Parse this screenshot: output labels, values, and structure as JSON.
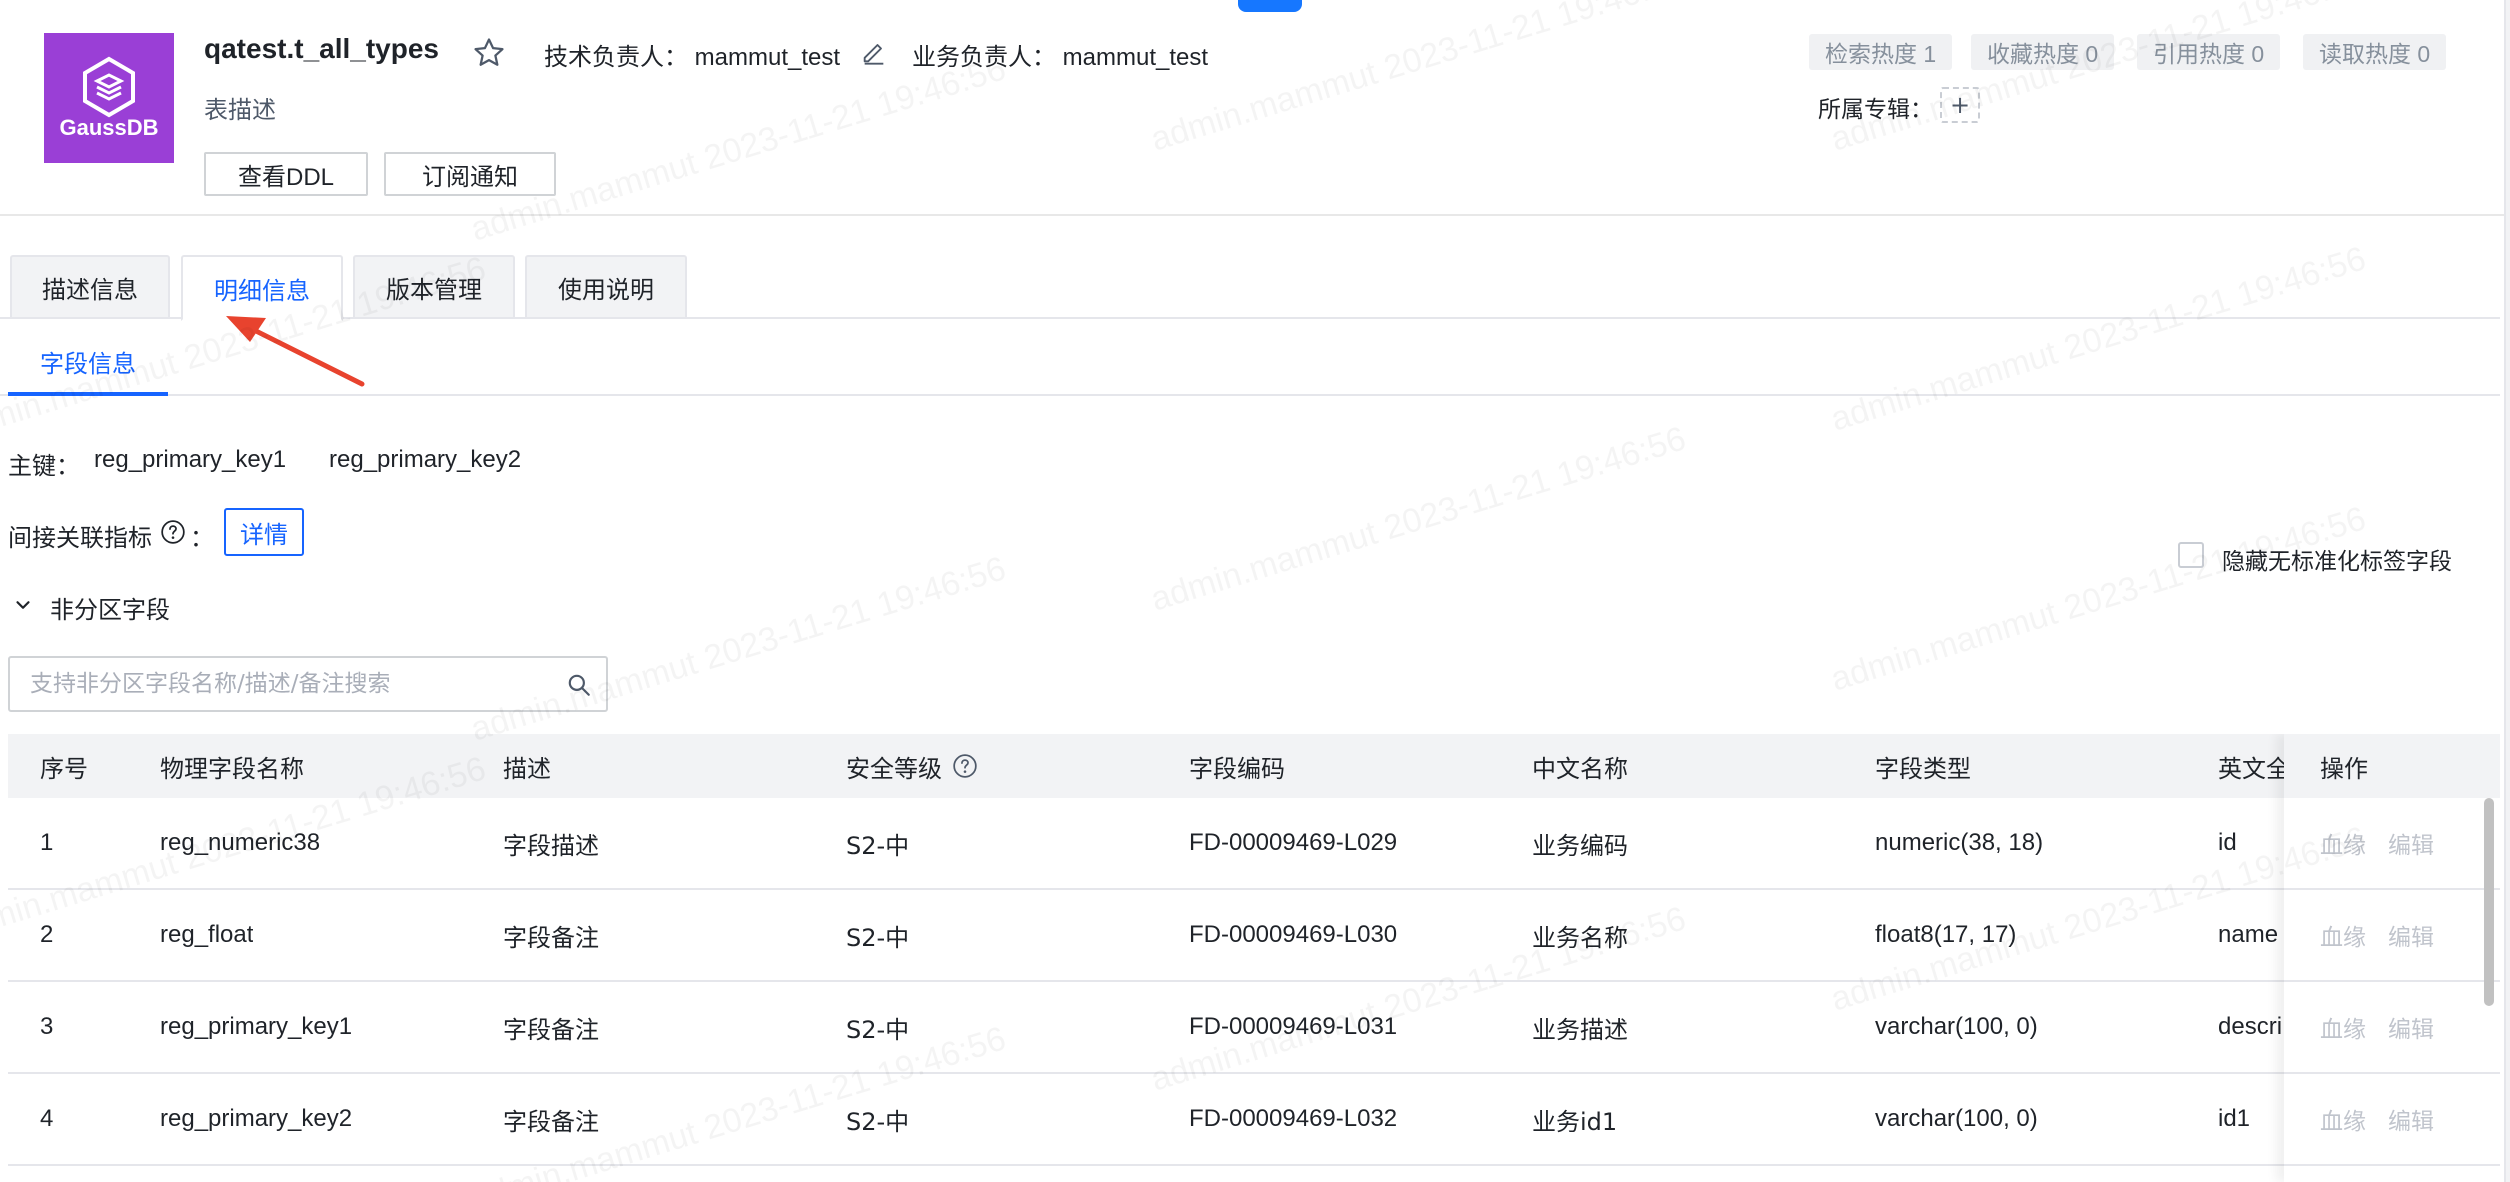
{
  "table_info": {
    "title": "qatest.t_all_types",
    "description": "表描述",
    "tech_owner_label": "技术负责人：",
    "tech_owner": "mammut_test",
    "biz_owner_label": "业务负责人：",
    "biz_owner": "mammut_test",
    "logo_text": "GaussDB"
  },
  "buttons": {
    "view_ddl": "查看DDL",
    "subscribe": "订阅通知",
    "detail": "详情"
  },
  "metrics": [
    {
      "label": "检索热度 1"
    },
    {
      "label": "收藏热度 0"
    },
    {
      "label": "引用热度 0"
    },
    {
      "label": "读取热度 0"
    }
  ],
  "album": {
    "label": "所属专辑：",
    "add": "+"
  },
  "tabs": [
    {
      "label": "描述信息"
    },
    {
      "label": "明细信息"
    },
    {
      "label": "版本管理"
    },
    {
      "label": "使用说明"
    }
  ],
  "subtab": "字段信息",
  "primary_key": {
    "label": "主键：",
    "values": [
      "reg_primary_key1",
      "reg_primary_key2"
    ]
  },
  "indirect_indicator": {
    "label": "间接关联指标",
    "colon": "："
  },
  "hide_unstandard": "隐藏无标准化标签字段",
  "non_partition": "非分区字段",
  "search": {
    "placeholder": "支持非分区字段名称/描述/备注搜索"
  },
  "table": {
    "columns": [
      "序号",
      "物理字段名称",
      "描述",
      "安全等级",
      "字段编码",
      "中文名称",
      "字段类型",
      "英文全",
      "操作"
    ],
    "rows": [
      {
        "no": "1",
        "name": "reg_numeric38",
        "desc": "字段描述",
        "level": "S2-中",
        "code": "FD-00009469-L029",
        "cn": "业务编码",
        "type": "numeric(38, 18)",
        "en": "id"
      },
      {
        "no": "2",
        "name": "reg_float",
        "desc": "字段备注",
        "level": "S2-中",
        "code": "FD-00009469-L030",
        "cn": "业务名称",
        "type": "float8(17, 17)",
        "en": "name"
      },
      {
        "no": "3",
        "name": "reg_primary_key1",
        "desc": "字段备注",
        "level": "S2-中",
        "code": "FD-00009469-L031",
        "cn": "业务描述",
        "type": "varchar(100, 0)",
        "en": "descri"
      },
      {
        "no": "4",
        "name": "reg_primary_key2",
        "desc": "字段备注",
        "level": "S2-中",
        "code": "FD-00009469-L032",
        "cn": "业务id1",
        "type": "varchar(100, 0)",
        "en": "id1"
      }
    ],
    "ops": {
      "lineage": "血缘",
      "edit": "编辑"
    }
  },
  "watermark": "admin.mammut 2023-11-21 19:46:56",
  "colors": {
    "accent": "#1664ff",
    "logo_bg": "#9a3fd6",
    "arrow": "#e8432e"
  }
}
